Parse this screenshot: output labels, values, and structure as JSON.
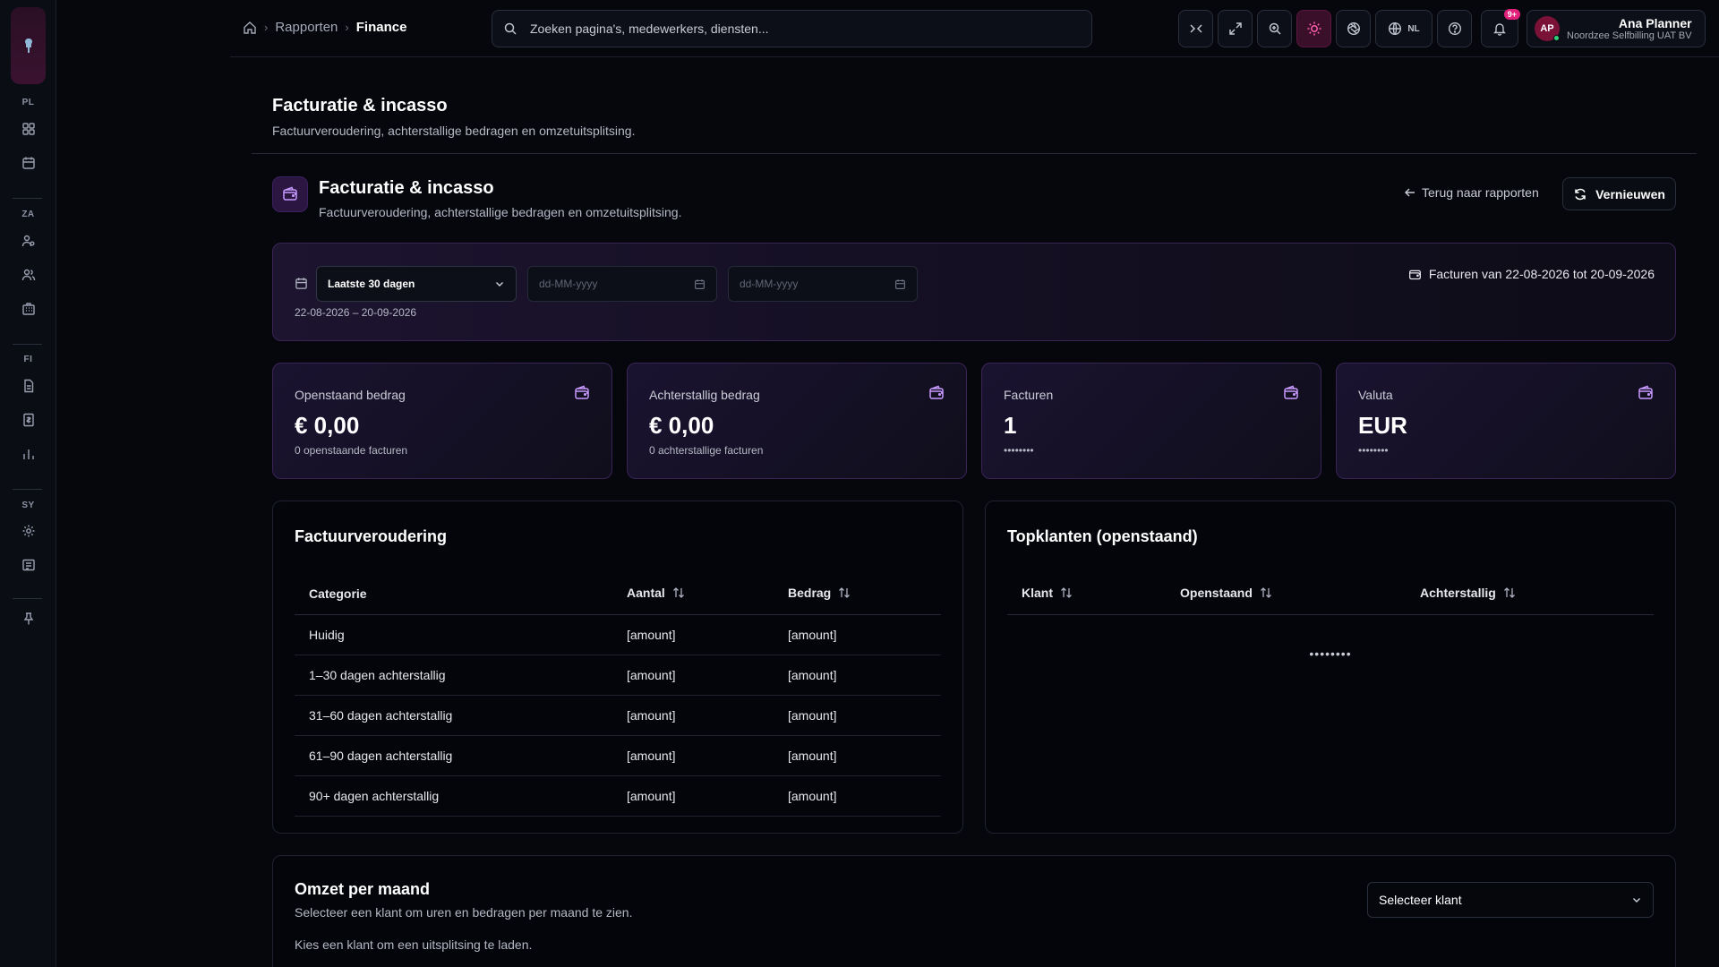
{
  "breadcrumb": {
    "items": [
      "Rapporten",
      "Finance"
    ]
  },
  "search": {
    "placeholder": "Zoeken pagina's, medewerkers, diensten..."
  },
  "toolbar": {
    "language": "NL",
    "notifications_badge": "9+"
  },
  "user": {
    "initials": "AP",
    "name": "Ana Planner",
    "org": "Noordzee Selfbilling UAT BV"
  },
  "sidebar": {
    "groups": [
      "PL",
      "ZA",
      "FI",
      "SY"
    ]
  },
  "page": {
    "title": "Facturatie & incasso",
    "subtitle": "Factuurveroudering, achterstallige bedragen en omzetuitsplitsing."
  },
  "section": {
    "title": "Facturatie & incasso",
    "subtitle": "Factuurveroudering, achterstallige bedragen en omzetuitsplitsing.",
    "back_label": "Terug naar rapporten",
    "refresh_label": "Vernieuwen"
  },
  "filter": {
    "period_selected": "Laatste 30 dagen",
    "from_placeholder": "dd-MM-yyyy",
    "to_placeholder": "dd-MM-yyyy",
    "range_text": "22-08-2026 – 20-09-2026",
    "info_text": "Facturen van 22-08-2026 tot 20-09-2026"
  },
  "kpis": [
    {
      "label": "Openstaand bedrag",
      "value": "€ 0,00",
      "note": "0 openstaande facturen"
    },
    {
      "label": "Achterstallig bedrag",
      "value": "€ 0,00",
      "note": "0 achterstallige facturen"
    },
    {
      "label": "Facturen",
      "value": "1",
      "note": "••••••••"
    },
    {
      "label": "Valuta",
      "value": "EUR",
      "note": "••••••••"
    }
  ],
  "aging": {
    "title": "Factuurveroudering",
    "columns": [
      "Categorie",
      "Aantal",
      "Bedrag"
    ],
    "rows": [
      [
        "Huidig",
        "[amount]",
        "[amount]"
      ],
      [
        "1–30 dagen achterstallig",
        "[amount]",
        "[amount]"
      ],
      [
        "31–60 dagen achterstallig",
        "[amount]",
        "[amount]"
      ],
      [
        "61–90 dagen achterstallig",
        "[amount]",
        "[amount]"
      ],
      [
        "90+ dagen achterstallig",
        "[amount]",
        "[amount]"
      ]
    ]
  },
  "top_clients": {
    "title": "Topklanten (openstaand)",
    "columns": [
      "Klant",
      "Openstaand",
      "Achterstallig"
    ],
    "empty": "••••••••"
  },
  "revenue": {
    "title": "Omzet per maand",
    "subtitle": "Selecteer een klant om uren en bedragen per maand te zien.",
    "hint": "Kies een klant om een uitsplitsing te laden.",
    "select_label": "Selecteer klant"
  },
  "colors": {
    "accent": "#c79aff",
    "active": "#ff5fb0",
    "badge": "#e0207a"
  }
}
